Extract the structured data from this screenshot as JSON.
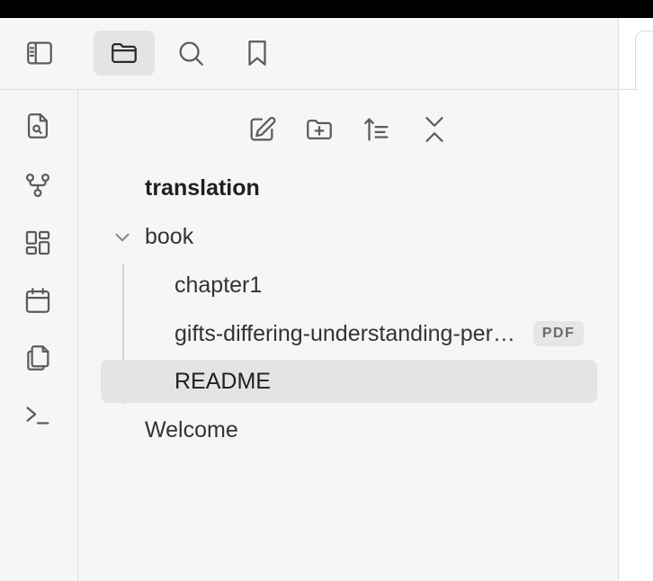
{
  "header": {
    "tabs": [
      {
        "name": "sidebar-toggle",
        "icon": "sidebar-left-icon"
      },
      {
        "name": "files",
        "icon": "folder-icon",
        "active": true
      },
      {
        "name": "search",
        "icon": "search-icon"
      },
      {
        "name": "bookmarks",
        "icon": "bookmark-icon"
      }
    ]
  },
  "ribbon": {
    "icons": [
      "file-search-icon",
      "graph-icon",
      "dashboard-icon",
      "calendar-icon",
      "copy-icon",
      "terminal-icon"
    ]
  },
  "explorer": {
    "actions": [
      "new-note-icon",
      "new-folder-icon",
      "sort-icon",
      "collapse-all-icon"
    ],
    "vault_name": "translation",
    "folder": {
      "name": "book",
      "expanded": true,
      "children": [
        {
          "label": "chapter1"
        },
        {
          "label": "gifts-differing-understanding-personality-type",
          "badge": "PDF"
        },
        {
          "label": "README",
          "selected": true
        }
      ]
    },
    "root_files": [
      {
        "label": "Welcome"
      }
    ]
  },
  "colors": {
    "background": "#f6f6f6",
    "selected": "#e4e4e4",
    "icon": "#5c5c5c",
    "text": "#333333"
  }
}
